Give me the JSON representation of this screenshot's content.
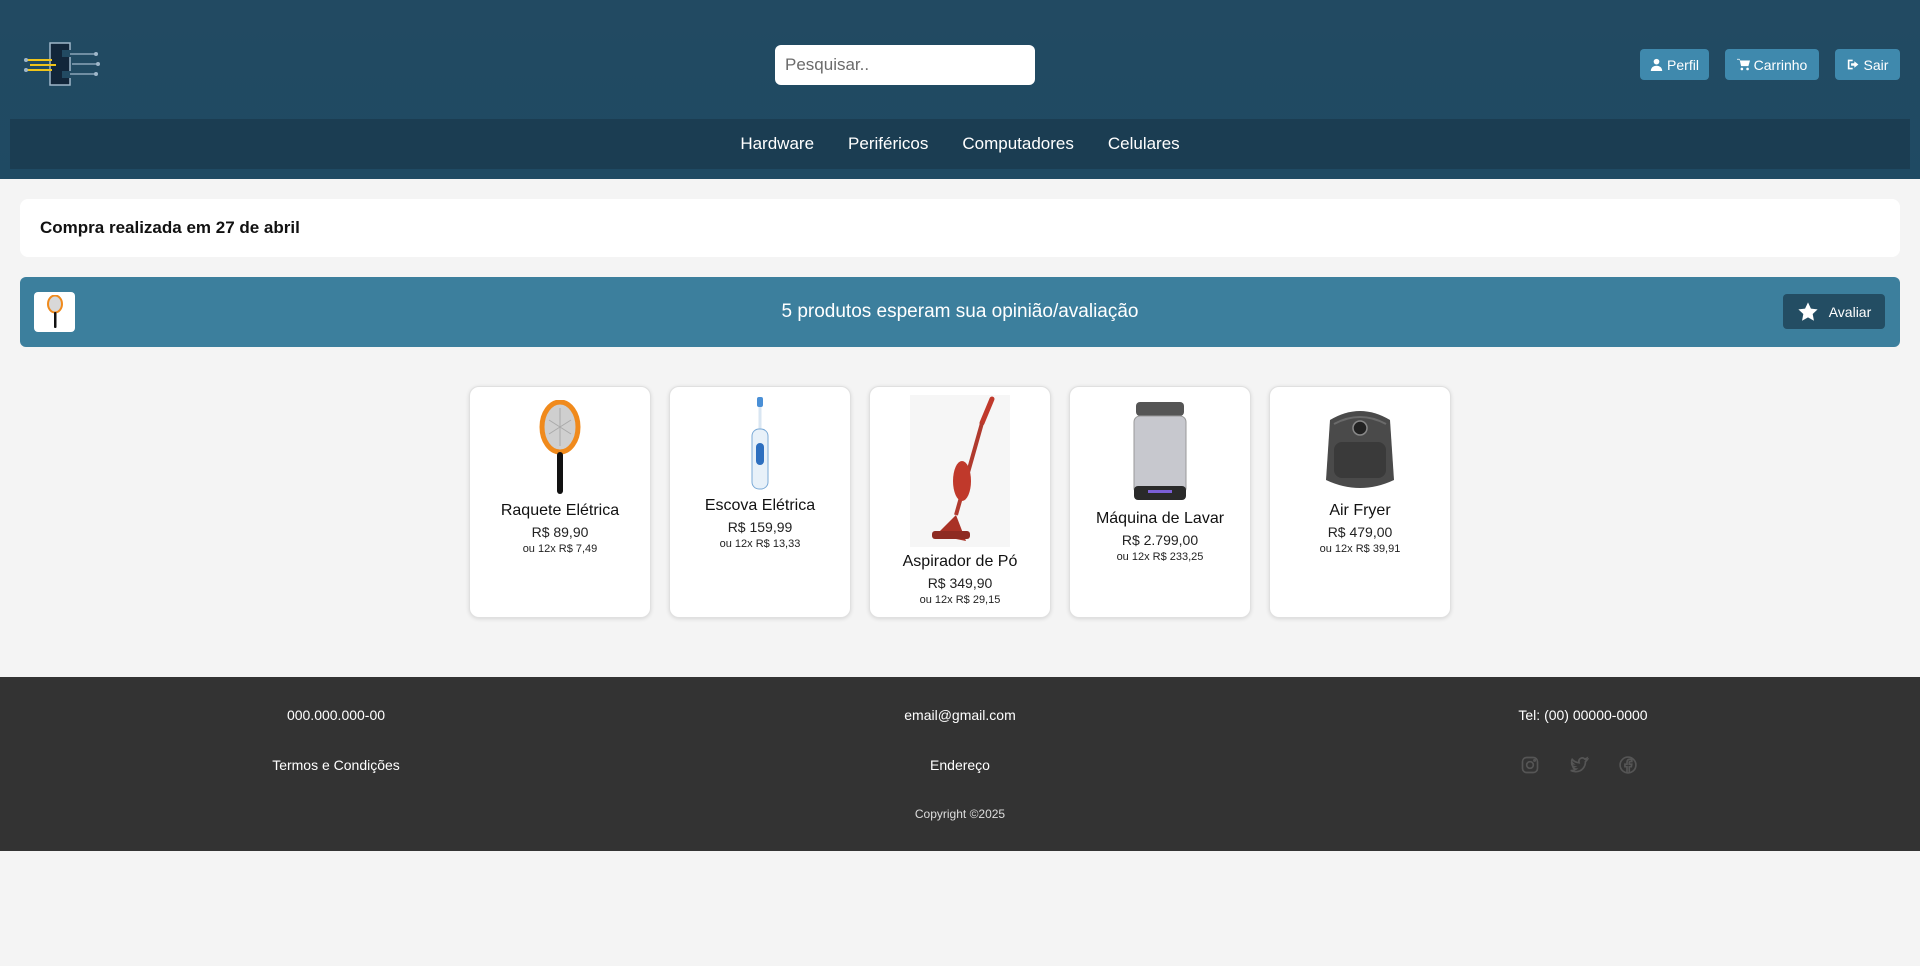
{
  "header": {
    "search_placeholder": "Pesquisar..",
    "buttons": {
      "perfil": "Perfil",
      "carrinho": "Carrinho",
      "sair": "Sair"
    }
  },
  "nav": {
    "items": [
      "Hardware",
      "Periféricos",
      "Computadores",
      "Celulares"
    ]
  },
  "purchase": {
    "title": "Compra realizada em 27 de abril"
  },
  "review_banner": {
    "message": "5 produtos esperam sua opinião/avaliação",
    "button_label": "Avaliar"
  },
  "products": [
    {
      "name": "Raquete Elétrica",
      "price": "R$ 89,90",
      "installments": "ou 12x R$ 7,49",
      "icon": "electric-racket"
    },
    {
      "name": "Escova Elétrica",
      "price": "R$ 159,99",
      "installments": "ou 12x R$ 13,33",
      "icon": "electric-toothbrush"
    },
    {
      "name": "Aspirador de Pó",
      "price": "R$ 349,90",
      "installments": "ou 12x R$ 29,15",
      "icon": "vacuum-cleaner"
    },
    {
      "name": "Máquina de Lavar",
      "price": "R$ 2.799,00",
      "installments": "ou 12x R$ 233,25",
      "icon": "washing-machine"
    },
    {
      "name": "Air Fryer",
      "price": "R$ 479,00",
      "installments": "ou 12x R$ 39,91",
      "icon": "air-fryer"
    }
  ],
  "footer": {
    "cpf": "000.000.000-00",
    "email": "email@gmail.com",
    "phone": "Tel: (00) 00000-0000",
    "terms": "Termos e Condições",
    "address": "Endereço",
    "copyright": "Copyright ©2025",
    "social_icons": [
      "instagram-icon",
      "twitter-icon",
      "facebook-icon"
    ]
  },
  "colors": {
    "header_bg": "#224a62",
    "nav_bg": "#1b3d52",
    "accent": "#3f89ad",
    "banner_bg": "#3c7f9d",
    "footer_bg": "#333333"
  }
}
